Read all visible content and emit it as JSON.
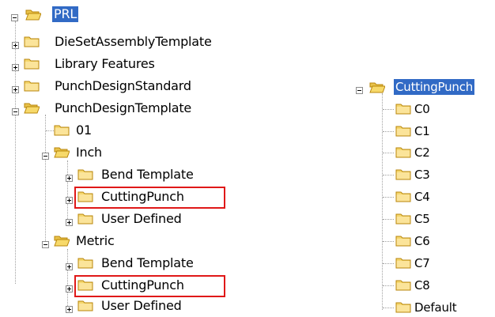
{
  "left_tree": {
    "root": "PRL",
    "items": [
      "DieSetAssemblyTemplate",
      "Library Features",
      "PunchDesignStandard",
      "PunchDesignTemplate",
      "01",
      "Inch",
      "Bend Template",
      "CuttingPunch",
      "User Defined",
      "Metric",
      "Bend Template",
      "CuttingPunch",
      "User Defined"
    ]
  },
  "right_tree": {
    "root": "CuttingPunch",
    "items": [
      "C0",
      "C1",
      "C2",
      "C3",
      "C4",
      "C5",
      "C6",
      "C7",
      "C8",
      "Default"
    ]
  },
  "colors": {
    "selection": "#316ac5",
    "highlight_box": "#e01818",
    "folder_fill": "#f5d76e",
    "folder_border": "#b8860b"
  }
}
